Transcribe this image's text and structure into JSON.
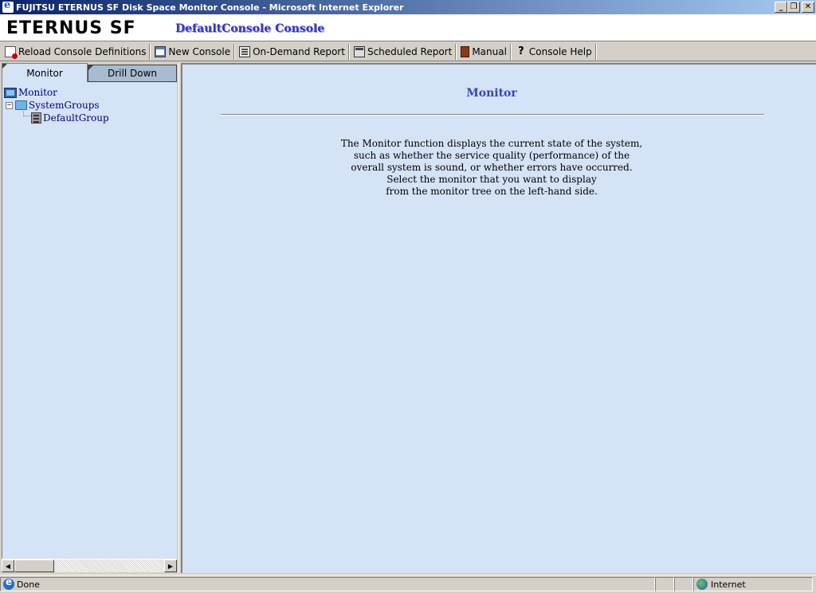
{
  "window": {
    "title": "FUJITSU ETERNUS SF Disk Space Monitor Console - Microsoft Internet Explorer",
    "buttons": {
      "minimize": "_",
      "restore": "❐",
      "close": "✕"
    }
  },
  "header": {
    "brand": "ETERNUS SF",
    "console_name": "DefaultConsole Console"
  },
  "toolbar": {
    "items": [
      {
        "label": "Reload Console Definitions",
        "icon": "reload-icon"
      },
      {
        "label": "New Console",
        "icon": "new-console-icon"
      },
      {
        "label": "On-Demand Report",
        "icon": "report-icon"
      },
      {
        "label": "Scheduled Report",
        "icon": "calendar-icon"
      },
      {
        "label": "Manual",
        "icon": "book-icon"
      },
      {
        "label": "Console Help",
        "icon": "help-icon"
      }
    ]
  },
  "left_panel": {
    "tabs": [
      {
        "label": "Monitor",
        "active": true
      },
      {
        "label": "Drill Down",
        "active": false
      }
    ],
    "tree": {
      "root": "Monitor",
      "folder": "SystemGroups",
      "folder_expander": "−",
      "group": "DefaultGroup"
    },
    "scrollbar": {
      "left_arrow": "◀",
      "right_arrow": "▶"
    }
  },
  "main": {
    "title": "Monitor",
    "description_lines": [
      "The Monitor function displays the current state of the system,",
      "such as whether the service quality (performance) of the",
      "overall system is sound, or whether errors have occurred.",
      "Select the monitor that you want to display",
      "from the monitor tree on the left-hand side."
    ]
  },
  "statusbar": {
    "status": "Done",
    "zone": "Internet"
  },
  "colors": {
    "titlebar_start": "#0a246a",
    "titlebar_end": "#a6caf0",
    "panel_bg": "#d4e3f5",
    "accent_title": "#3344cc"
  }
}
